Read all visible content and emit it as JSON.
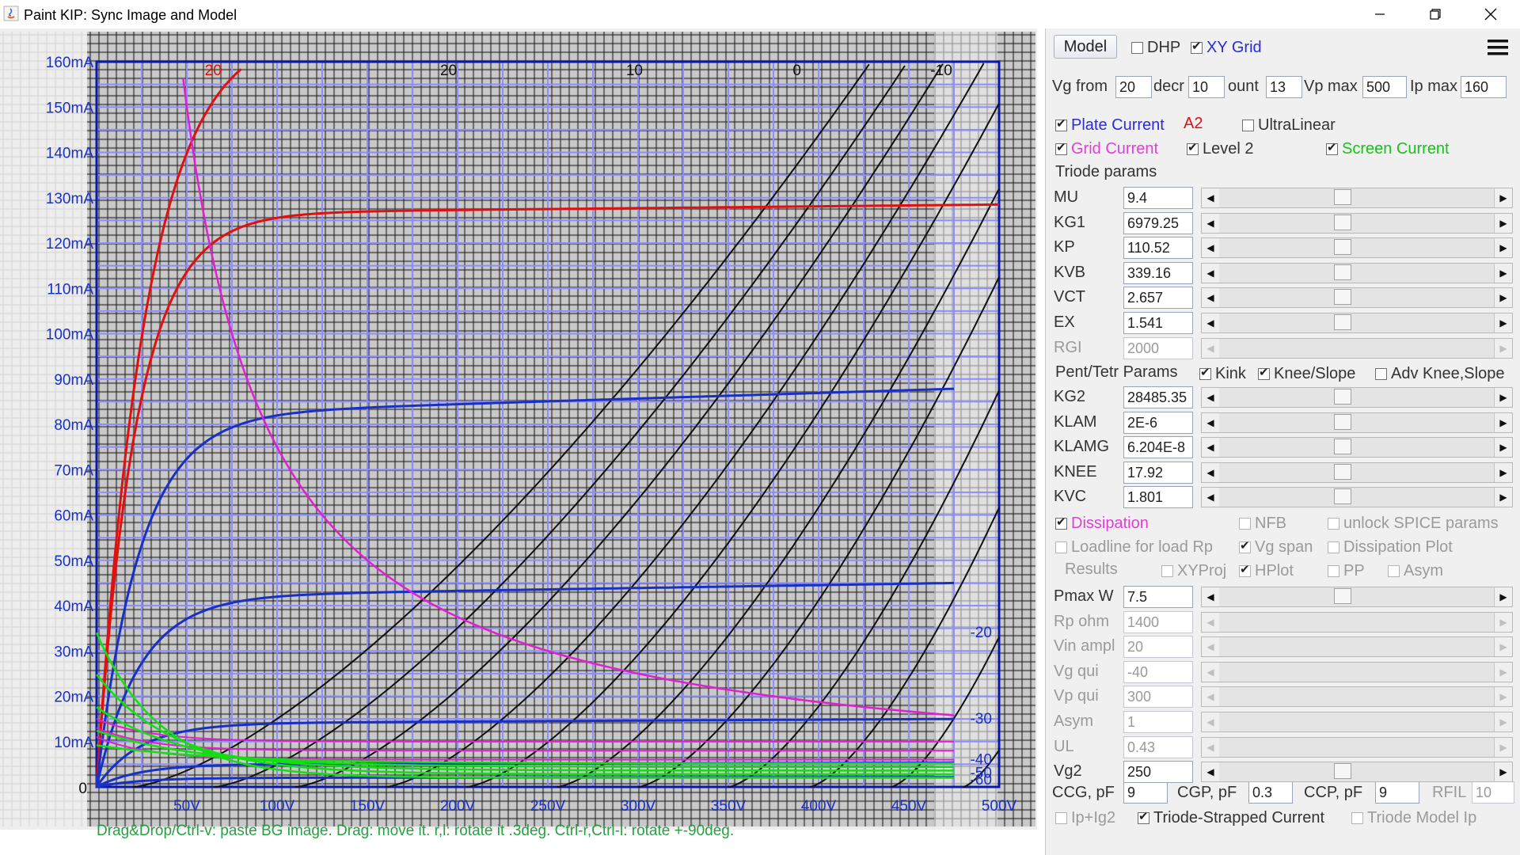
{
  "window": {
    "title": "Paint KIP: Sync Image and Model"
  },
  "plot": {
    "x_ticks": [
      "50V",
      "100V",
      "150V",
      "200V",
      "250V",
      "300V",
      "350V",
      "400V",
      "450V",
      "500V"
    ],
    "y_ticks": [
      "160mA",
      "150mA",
      "140mA",
      "130mA",
      "120mA",
      "110mA",
      "100mA",
      "90mA",
      "80mA",
      "70mA",
      "60mA",
      "50mA",
      "40mA",
      "30mA",
      "20mA",
      "10mA"
    ],
    "origin_label": "0",
    "help_text": "Drag&Drop/Ctrl-v: paste BG image. Drag: move it. r,l: rotate it .3deg. Ctrl-r,Ctrl-l: rotate +-90deg.",
    "curve_labels_top": [
      "20",
      "10",
      "0",
      "-10"
    ],
    "curve_labels_right": [
      "-20",
      "-30",
      "-40",
      "-50",
      "-60"
    ],
    "red_curve_label": "20",
    "xlim": [
      0,
      500
    ],
    "ylim": [
      0,
      160
    ],
    "colors": {
      "grid": "#8d8dff",
      "frame": "#0a1aa8",
      "plate": "#111111",
      "red": "#e01010",
      "blue": "#1830c8",
      "magenta": "#e020d0",
      "green": "#10e010",
      "help": "#27a043"
    }
  },
  "panel": {
    "model_button": "Model",
    "dhp": "DHP",
    "xy_grid": "XY Grid",
    "vg_from_label": "Vg from",
    "vg_from": "20",
    "decr_label": "decr",
    "decr": "10",
    "count_label": "ount",
    "count": "13",
    "vp_max_label": "Vp max",
    "vp_max": "500",
    "ip_max_label": "Ip max",
    "ip_max": "160",
    "plate_current": "Plate Current",
    "a2": "A2",
    "ultralinear": "UltraLinear",
    "grid_current": "Grid Current",
    "level2": "Level 2",
    "screen_current": "Screen Current",
    "triode_params": "Triode params",
    "params": [
      {
        "name": "MU",
        "value": "9.4"
      },
      {
        "name": "KG1",
        "value": "6979.25"
      },
      {
        "name": "KP",
        "value": "110.52"
      },
      {
        "name": "KVB",
        "value": "339.16"
      },
      {
        "name": "VCT",
        "value": "2.657"
      },
      {
        "name": "EX",
        "value": "1.541"
      },
      {
        "name": "RGI",
        "value": "2000"
      }
    ],
    "pent_params": "Pent/Tetr Params",
    "kink": "Kink",
    "knee_slope": "Knee/Slope",
    "adv_knee": "Adv Knee,Slope",
    "pent": [
      {
        "name": "KG2",
        "value": "28485.35"
      },
      {
        "name": "KLAM",
        "value": "2E-6"
      },
      {
        "name": "KLAMG",
        "value": "6.204E-8"
      },
      {
        "name": "KNEE",
        "value": "17.92"
      },
      {
        "name": "KVC",
        "value": "1.801"
      }
    ],
    "dissipation": "Dissipation",
    "nfb": "NFB",
    "unlock_spice": "unlock SPICE params",
    "loadline": "Loadline for load Rp",
    "vg_span": "Vg span",
    "dissipation_plot": "Dissipation Plot",
    "results": "Results",
    "xyproj": "XYProj",
    "hplot": "HPlot",
    "pp": "PP",
    "asym": "Asym",
    "load": [
      {
        "name": "Pmax W",
        "value": "7.5"
      },
      {
        "name": "Rp ohm",
        "value": "1400"
      },
      {
        "name": "Vin ampl",
        "value": "20"
      },
      {
        "name": "Vg qui",
        "value": "-40"
      },
      {
        "name": "Vp qui",
        "value": "300"
      },
      {
        "name": "Asym",
        "value": "1"
      },
      {
        "name": "UL",
        "value": "0.43"
      },
      {
        "name": "Vg2",
        "value": "250"
      }
    ],
    "ccg_label": "CCG, pF",
    "ccg": "9",
    "cgp_label": "CGP, pF",
    "cgp": "0.3",
    "ccp_label": "CCP, pF",
    "ccp": "9",
    "rfil_label": "RFIL",
    "rfil": "10",
    "ip_ig2": "Ip+Ig2",
    "triode_strapped": "Triode-Strapped Current",
    "triode_model_ip": "Triode Model Ip"
  }
}
